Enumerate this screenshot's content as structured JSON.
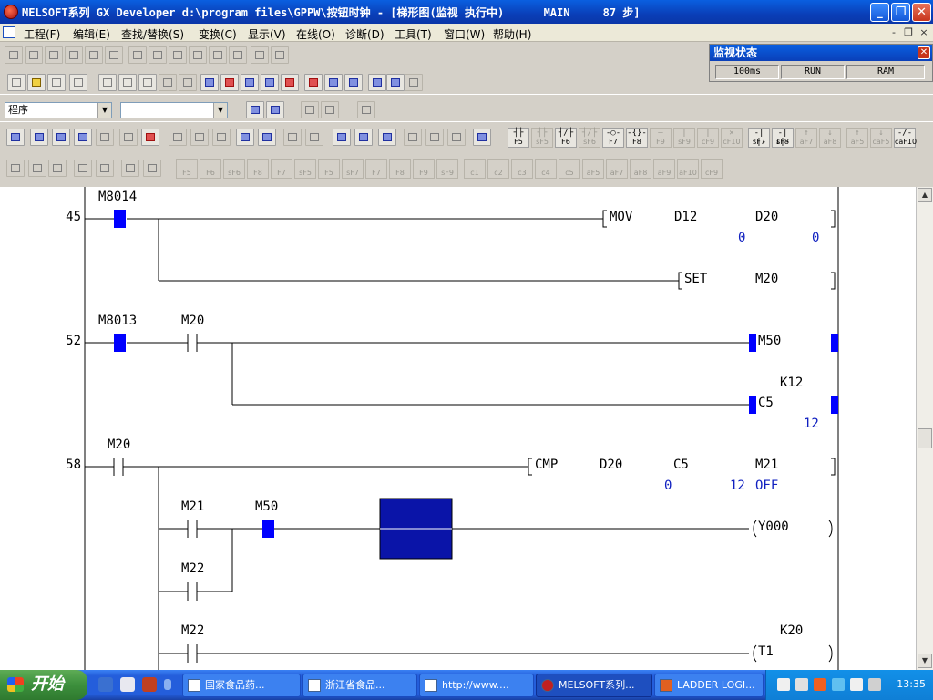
{
  "window": {
    "title": "MELSOFT系列 GX Developer d:\\program files\\GPPW\\按钮时钟 - [梯形图(监视 执行中)      MAIN     87 步]",
    "min_glyph": "_",
    "max_glyph": "❐",
    "close_glyph": "✕"
  },
  "menu": {
    "items": [
      "工程(F)",
      "编辑(E)",
      "查找/替换(S)",
      "变换(C)",
      "显示(V)",
      "在线(O)",
      "诊断(D)",
      "工具(T)",
      "窗口(W)",
      "帮助(H)"
    ],
    "mdi_min": "-",
    "mdi_restore": "❐",
    "mdi_close": "×"
  },
  "toolbar": {
    "program_combo": "程序",
    "second_combo": "",
    "combo_arrow": "▼",
    "fkeys_row3": [
      {
        "sym": "┤├",
        "label": "F5",
        "enabled": true
      },
      {
        "sym": "┤├",
        "label": "sF5",
        "enabled": false
      },
      {
        "sym": "┤/├",
        "label": "F6",
        "enabled": true
      },
      {
        "sym": "┤/├",
        "label": "sF6",
        "enabled": false
      },
      {
        "sym": "-○-",
        "label": "F7",
        "enabled": true
      },
      {
        "sym": "-{}-",
        "label": "F8",
        "enabled": true
      },
      {
        "sym": "—",
        "label": "F9",
        "enabled": false
      },
      {
        "sym": "|",
        "label": "sF9",
        "enabled": false
      },
      {
        "sym": "|",
        "label": "cF9",
        "enabled": false
      },
      {
        "sym": "✕",
        "label": "cF10",
        "enabled": false
      },
      {
        "sym": "-|↑|-",
        "label": "sF7",
        "enabled": true
      },
      {
        "sym": "-|↓|-",
        "label": "sF8",
        "enabled": true
      },
      {
        "sym": "↑",
        "label": "aF7",
        "enabled": false
      },
      {
        "sym": "↓",
        "label": "aF8",
        "enabled": false
      },
      {
        "sym": "↑",
        "label": "aF5",
        "enabled": false
      },
      {
        "sym": "↓",
        "label": "caF5",
        "enabled": false
      },
      {
        "sym": "-/-",
        "label": "caF10",
        "enabled": true
      }
    ],
    "fkeys_row4": [
      "F5",
      "F6",
      "sF6",
      "F8",
      "F7",
      "sF5",
      "F5",
      "sF7",
      "F7",
      "F8",
      "F9",
      "sF9",
      "c1",
      "c2",
      "c3",
      "c4",
      "c5",
      "aF5",
      "aF7",
      "aF8",
      "aF9",
      "aF10",
      "cF9"
    ]
  },
  "monitor": {
    "title": "监视状态",
    "close_glyph": "✕",
    "scan_time": "100ms",
    "run_state": "RUN",
    "memory": "RAM"
  },
  "ladder": {
    "steps": [
      "45",
      "52",
      "58"
    ],
    "rung45": {
      "contact": "M8014",
      "instr": "MOV",
      "src": "D12",
      "dst": "D20",
      "src_val": "0",
      "dst_val": "0",
      "set_instr": "SET",
      "set_dev": "M20"
    },
    "rung52": {
      "contact1": "M8013",
      "contact2": "M20",
      "coil1": "M50",
      "counter": "C5",
      "counter_k": "K12",
      "counter_val": "12"
    },
    "rung58": {
      "contact": "M20",
      "instr": "CMP",
      "op1": "D20",
      "op2": "C5",
      "dst": "M21",
      "op1_val": "0",
      "op2_val": "12",
      "dst_val": "OFF",
      "m21": "M21",
      "m50": "M50",
      "m22": "M22",
      "coil": "Y000",
      "m22b": "M22",
      "timer": "T1",
      "timer_k": "K20"
    }
  },
  "scrollbar": {
    "up_glyph": "▲",
    "down_glyph": "▼"
  },
  "taskbar": {
    "start_label": "开始",
    "tasks": [
      {
        "label": "国家食品药...",
        "active": false
      },
      {
        "label": "浙江省食品...",
        "active": false
      },
      {
        "label": "http://www....",
        "active": false
      },
      {
        "label": "MELSOFT系列...",
        "active": true
      },
      {
        "label": "LADDER LOGI...",
        "active": false
      }
    ],
    "clock": "13:35"
  },
  "colors": {
    "active_contact": "#0000ff",
    "monitor_value": "#1020c0",
    "energized_block": "#0a14a8"
  }
}
